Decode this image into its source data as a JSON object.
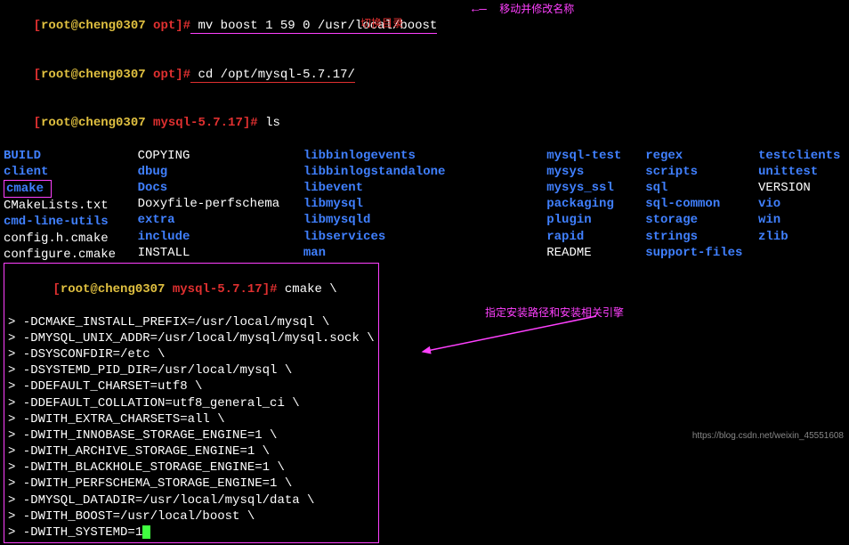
{
  "prompts": {
    "p1_user": "[root@cheng0307 opt]#",
    "p1_cmd": " mv boost 1 59 0 /usr/local/boost",
    "p2_user": "[root@cheng0307 opt]#",
    "p2_cmd": " cd /opt/mysql-5.7.17/",
    "p3_user": "[root@cheng0307 mysql-5.7.17]#",
    "p3_cmd": " ls",
    "p4_user": "[root@cheng0307 mysql-5.7.17]#",
    "p4_cmd": " cmake \\"
  },
  "annotations": {
    "a1_arrow": "←—",
    "a1": "移动并修改名称",
    "a2": "切换目录",
    "a3": "指定安装路径和安装相关引擎"
  },
  "ls": {
    "col1": [
      "BUILD",
      "client",
      "cmake",
      "CMakeLists.txt",
      "cmd-line-utils",
      "config.h.cmake",
      "configure.cmake"
    ],
    "col2": [
      "COPYING",
      "dbug",
      "Docs",
      "Doxyfile-perfschema",
      "extra",
      "include",
      "INSTALL"
    ],
    "col3": [
      "libbinlogevents",
      "libbinlogstandalone",
      "libevent",
      "libmysql",
      "libmysqld",
      "libservices",
      "man"
    ],
    "col4": [
      "mysql-test",
      "mysys",
      "mysys_ssl",
      "packaging",
      "plugin",
      "rapid",
      "README"
    ],
    "col5": [
      "regex",
      "scripts",
      "sql",
      "sql-common",
      "storage",
      "strings",
      "support-files"
    ],
    "col6": [
      "testclients",
      "unittest",
      "VERSION",
      "vio",
      "win",
      "zlib"
    ]
  },
  "cmake_lines": [
    "> -DCMAKE_INSTALL_PREFIX=/usr/local/mysql \\",
    "> -DMYSQL_UNIX_ADDR=/usr/local/mysql/mysql.sock \\",
    "> -DSYSCONFDIR=/etc \\",
    "> -DSYSTEMD_PID_DIR=/usr/local/mysql \\",
    "> -DDEFAULT_CHARSET=utf8 \\",
    "> -DDEFAULT_COLLATION=utf8_general_ci \\",
    "> -DWITH_EXTRA_CHARSETS=all \\",
    "> -DWITH_INNOBASE_STORAGE_ENGINE=1 \\",
    "> -DWITH_ARCHIVE_STORAGE_ENGINE=1 \\",
    "> -DWITH_BLACKHOLE_STORAGE_ENGINE=1 \\",
    "> -DWITH_PERFSCHEMA_STORAGE_ENGINE=1 \\",
    "> -DMYSQL_DATADIR=/usr/local/mysql/data \\",
    "> -DWITH_BOOST=/usr/local/boost \\",
    "> -DWITH_SYSTEMD=1"
  ],
  "watermark": "https://blog.csdn.net/weixin_45551608"
}
